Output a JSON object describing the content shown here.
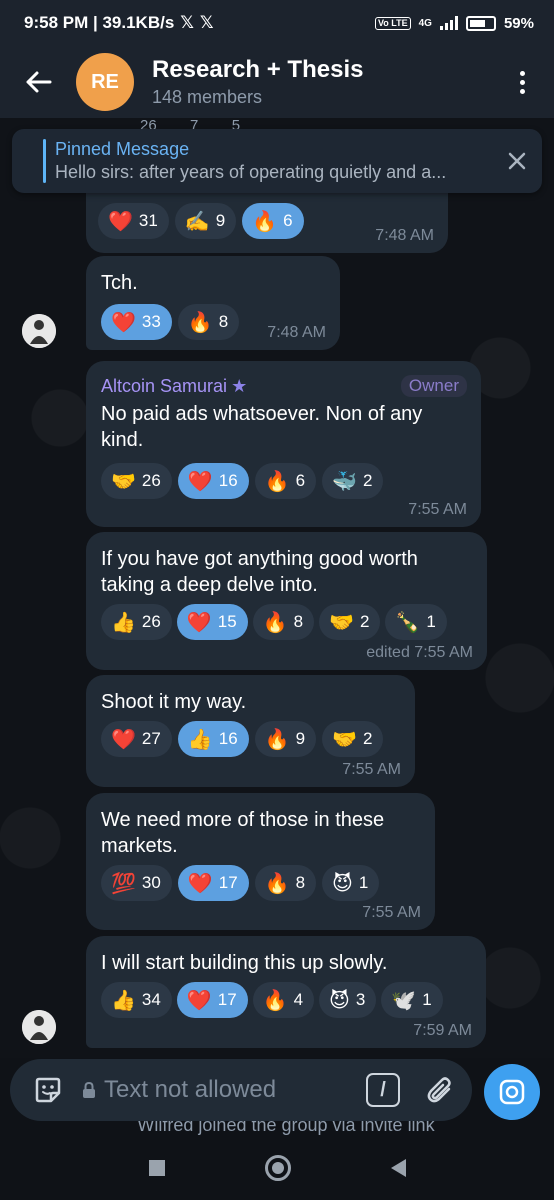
{
  "status_bar": {
    "time_speed": "9:58 PM | 39.1KB/s",
    "x_icons": "𝕏 𝕏",
    "vo_lte": "Vo LTE",
    "network": "4G",
    "battery": "59%"
  },
  "header": {
    "avatar_initials": "RE",
    "title": "Research + Thesis",
    "subtitle": "148 members"
  },
  "partial_reactions_above": "26        7        5",
  "pinned": {
    "title": "Pinned Message",
    "text": "Hello sirs: after years of operating quietly and a..."
  },
  "messages": [
    {
      "reactions": [
        {
          "emoji": "❤️",
          "count": "31",
          "mine": false
        },
        {
          "emoji": "✍️",
          "count": "9",
          "mine": false
        },
        {
          "emoji": "🔥",
          "count": "6",
          "mine": true
        }
      ],
      "time": "7:48 AM"
    },
    {
      "text": "Tch.",
      "reactions": [
        {
          "emoji": "❤️",
          "count": "33",
          "mine": true
        },
        {
          "emoji": "🔥",
          "count": "8",
          "mine": false
        }
      ],
      "time": "7:48 AM"
    },
    {
      "sender": "Altcoin Samurai",
      "sender_badge": "★",
      "role": "Owner",
      "text": "No paid ads whatsoever. Non of any kind.",
      "reactions": [
        {
          "emoji": "🤝",
          "count": "26",
          "mine": false
        },
        {
          "emoji": "❤️",
          "count": "16",
          "mine": true
        },
        {
          "emoji": "🔥",
          "count": "6",
          "mine": false
        },
        {
          "emoji": "🐳",
          "count": "2",
          "mine": false
        }
      ],
      "time": "7:55 AM"
    },
    {
      "text": "If you have got anything good worth taking a deep delve into.",
      "reactions": [
        {
          "emoji": "👍",
          "count": "26",
          "mine": false
        },
        {
          "emoji": "❤️",
          "count": "15",
          "mine": true
        },
        {
          "emoji": "🔥",
          "count": "8",
          "mine": false
        },
        {
          "emoji": "🤝",
          "count": "2",
          "mine": false
        },
        {
          "emoji": "🍾",
          "count": "1",
          "mine": false
        }
      ],
      "time": "edited 7:55 AM"
    },
    {
      "text": "Shoot it my way.",
      "reactions": [
        {
          "emoji": "❤️",
          "count": "27",
          "mine": false
        },
        {
          "emoji": "👍",
          "count": "16",
          "mine": true
        },
        {
          "emoji": "🔥",
          "count": "9",
          "mine": false
        },
        {
          "emoji": "🤝",
          "count": "2",
          "mine": false
        }
      ],
      "time": "7:55 AM"
    },
    {
      "text": "We need more of those in these markets.",
      "reactions": [
        {
          "emoji": "💯",
          "count": "30",
          "mine": false
        },
        {
          "emoji": "❤️",
          "count": "17",
          "mine": true
        },
        {
          "emoji": "🔥",
          "count": "8",
          "mine": false
        },
        {
          "emoji": "😈",
          "count": "1",
          "mine": false
        }
      ],
      "time": "7:55 AM"
    },
    {
      "text": "I will start building this up slowly.",
      "reactions": [
        {
          "emoji": "👍",
          "count": "34",
          "mine": false
        },
        {
          "emoji": "❤️",
          "count": "17",
          "mine": true
        },
        {
          "emoji": "🔥",
          "count": "4",
          "mine": false
        },
        {
          "emoji": "😈",
          "count": "3",
          "mine": false
        },
        {
          "emoji": "🕊️",
          "count": "1",
          "mine": false
        }
      ],
      "time": "7:59 AM"
    }
  ],
  "input": {
    "placeholder": "Text not allowed",
    "command_glyph": "/"
  },
  "system_message": "Wilfred joined the group via invite link",
  "colors": {
    "header_bg": "#1c232d",
    "bubble_bg": "#212b36",
    "reaction_bg": "#2c3846",
    "reaction_mine_bg": "#5da0e0",
    "accent": "#5eb5f7",
    "avatar_orange": "#f0a04b",
    "sender_purple": "#a693f5"
  }
}
